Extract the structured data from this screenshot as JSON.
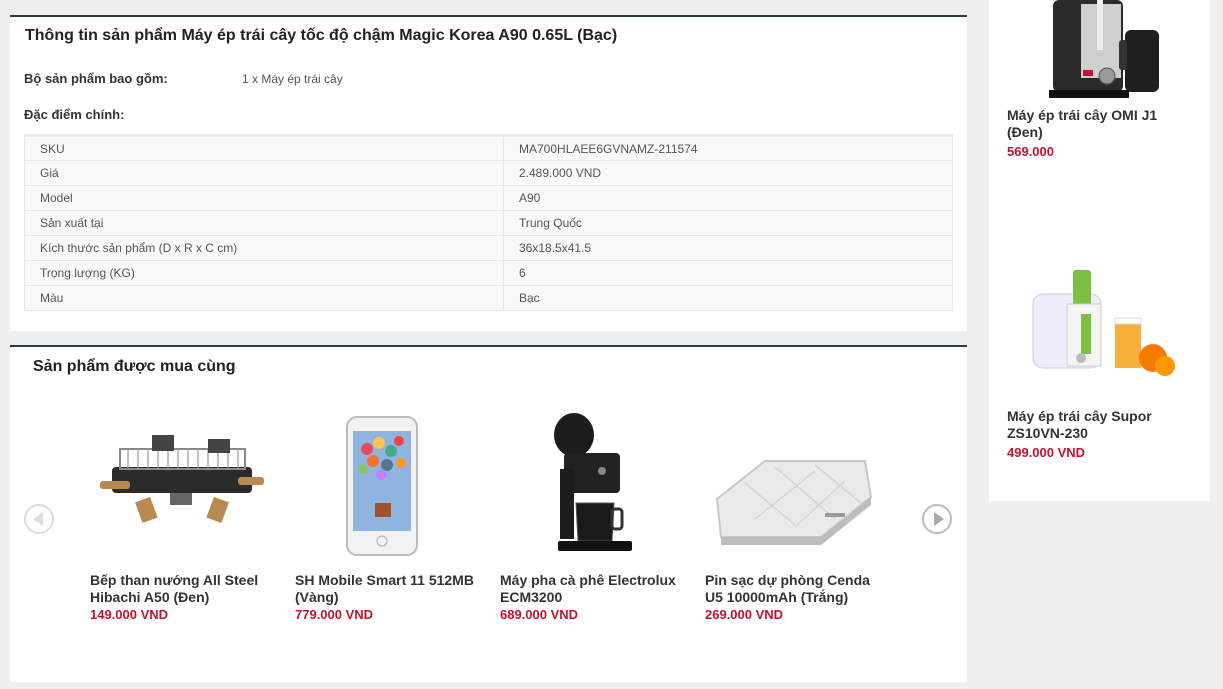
{
  "info": {
    "title": "Thông tin sản phẩm Máy ép trái cây tốc độ chậm Magic Korea A90 0.65L (Bạc)",
    "bundle_label": "Bộ sản phẩm bao gồm:",
    "bundle_value": "1 x Máy ép trái cây",
    "features_label": "Đặc điểm chính:",
    "specs": [
      {
        "key": "SKU",
        "value": "MA700HLAEE6GVNAMZ-211574"
      },
      {
        "key": "Giá",
        "value": "2.489.000 VND"
      },
      {
        "key": "Model",
        "value": "A90"
      },
      {
        "key": "Sản xuất tại",
        "value": "Trung Quốc"
      },
      {
        "key": "Kích thước sản phẩm (D x R x C cm)",
        "value": "36x18.5x41.5"
      },
      {
        "key": "Trọng lượng (KG)",
        "value": "6"
      },
      {
        "key": "Màu",
        "value": "Bạc"
      }
    ]
  },
  "bought": {
    "title": "Sản phẩm được mua cùng",
    "items": [
      {
        "name": "Bếp than nướng All Steel Hibachi A50 (Đen)",
        "price": "149.000 VND",
        "icon": "grill-image"
      },
      {
        "name": "SH Mobile Smart 11 512MB (Vàng)",
        "price": "779.000 VND",
        "icon": "phone-image"
      },
      {
        "name": "Máy pha cà phê Electrolux ECM3200",
        "price": "689.000 VND",
        "icon": "coffee-maker-image"
      },
      {
        "name": "Pin sạc dự phòng Cenda U5 10000mAh (Trắng)",
        "price": "269.000 VND",
        "icon": "power-bank-image"
      }
    ]
  },
  "sidebar": {
    "items": [
      {
        "name": "Máy ép trái cây OMI J1 (Đen)",
        "price": "569.000",
        "icon": "juicer-black-image"
      },
      {
        "name": "Máy ép trái cây Supor ZS10VN-230",
        "price": "499.000 VND",
        "icon": "juicer-white-image"
      }
    ]
  },
  "colors": {
    "price": "#c8102e",
    "accent_border": "#2a3a4a"
  }
}
